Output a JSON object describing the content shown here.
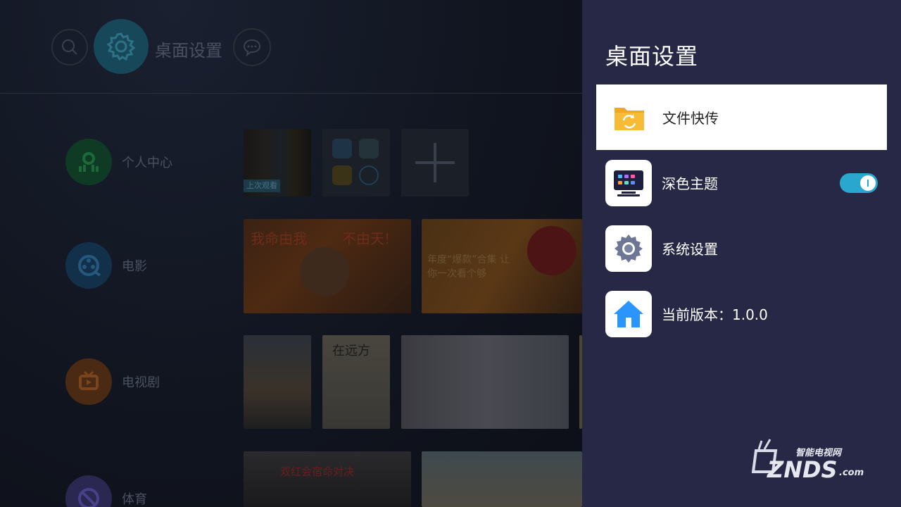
{
  "topbar": {
    "title": "桌面设置"
  },
  "sidebar": {
    "items": [
      {
        "label": "个人中心",
        "color": "#1f8f4c"
      },
      {
        "label": "电影",
        "color": "#2f6e9e"
      },
      {
        "label": "电视剧",
        "color": "#c96a23"
      },
      {
        "label": "体育",
        "color": "#5a52b3"
      }
    ]
  },
  "content": {
    "recent_badge": "上次观看",
    "poster_texts": {
      "nezha_1": "我命由我",
      "nezha_2": "不由天!",
      "promo": "年度“爆款”合集 让你一次看个够",
      "drama": "在远方",
      "sports": "双红会宿命对决"
    }
  },
  "panel": {
    "title": "桌面设置",
    "items": [
      {
        "label": "文件快传",
        "icon": "folder-sync-icon",
        "active": true
      },
      {
        "label": "深色主题",
        "icon": "dark-theme-icon",
        "toggle": true
      },
      {
        "label": "系统设置",
        "icon": "settings-gear-icon"
      },
      {
        "label": "当前版本：1.0.0",
        "icon": "home-icon"
      }
    ]
  },
  "watermark": {
    "top": "智能电视网",
    "brand": "ZNDS",
    "suffix": ".com"
  },
  "colors": {
    "panel_bg": "#262845",
    "toggle_on": "#29a7cf",
    "accent": "#16485a"
  }
}
